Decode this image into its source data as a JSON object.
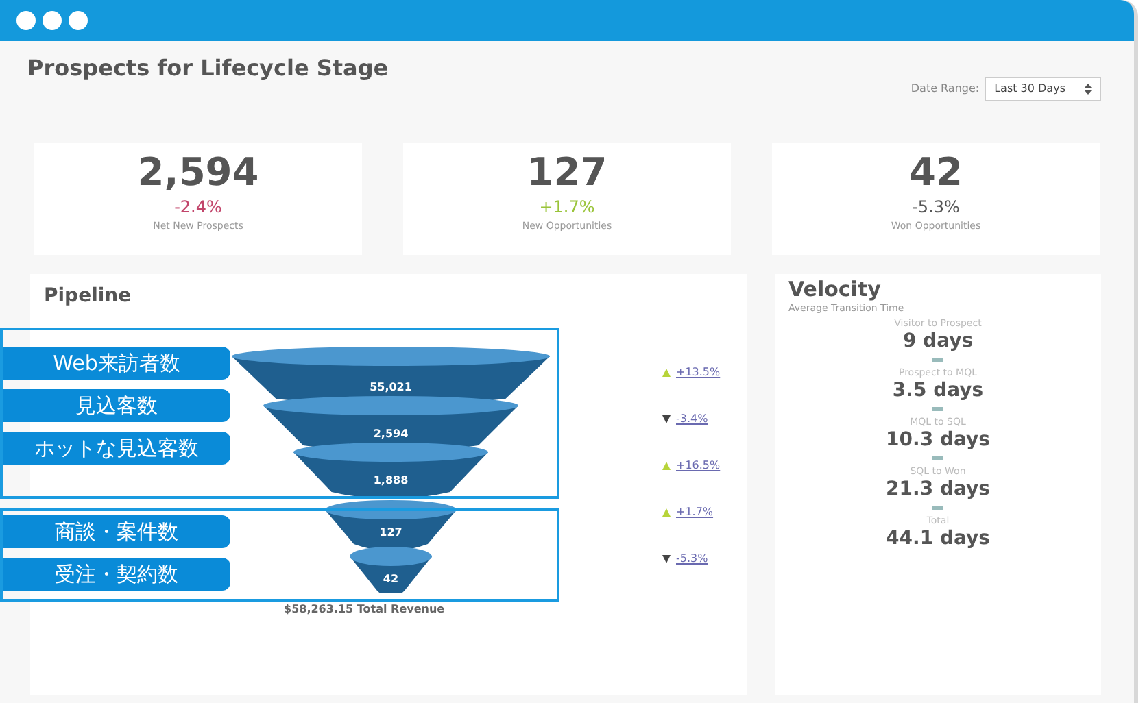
{
  "title": "Prospects for Lifecycle Stage",
  "date_range": {
    "label": "Date Range:",
    "value": "Last 30 Days"
  },
  "kpis": [
    {
      "value": "2,594",
      "change": "-2.4%",
      "color": "#c2456b",
      "label": "Net New Prospects"
    },
    {
      "value": "127",
      "change": "+1.7%",
      "color": "#9ac43a",
      "label": "New Opportunities"
    },
    {
      "value": "42",
      "change": "-5.3%",
      "color": "#555555",
      "label": "Won Opportunities"
    }
  ],
  "pipeline": {
    "title": "Pipeline",
    "stages": [
      {
        "value": "55,021",
        "change": "+13.5%",
        "kind": "rise"
      },
      {
        "value": "2,594",
        "change": "-3.4%",
        "kind": "fall"
      },
      {
        "value": "1,888",
        "change": "+16.5%",
        "kind": "rise"
      },
      {
        "value": "127",
        "change": "+1.7%",
        "kind": "rise"
      },
      {
        "value": "42",
        "change": "-5.3%",
        "kind": "fall"
      }
    ],
    "total": "$58,263.15 Total Revenue"
  },
  "velocity": {
    "title": "Velocity",
    "subtitle": "Average Transition Time",
    "steps": [
      {
        "label": "Visitor to Prospect",
        "value": "9 days"
      },
      {
        "label": "Prospect to MQL",
        "value": "3.5 days"
      },
      {
        "label": "MQL to SQL",
        "value": "10.3 days"
      },
      {
        "label": "SQL to Won",
        "value": "21.3 days"
      },
      {
        "label": "Total",
        "value": "44.1 days"
      }
    ]
  },
  "annotation_groups": [
    {
      "labels": [
        "Web来訪者数",
        "見込客数",
        "ホットな見込客数"
      ]
    },
    {
      "labels": [
        "商談・案件数",
        "受注・契約数"
      ]
    }
  ]
}
